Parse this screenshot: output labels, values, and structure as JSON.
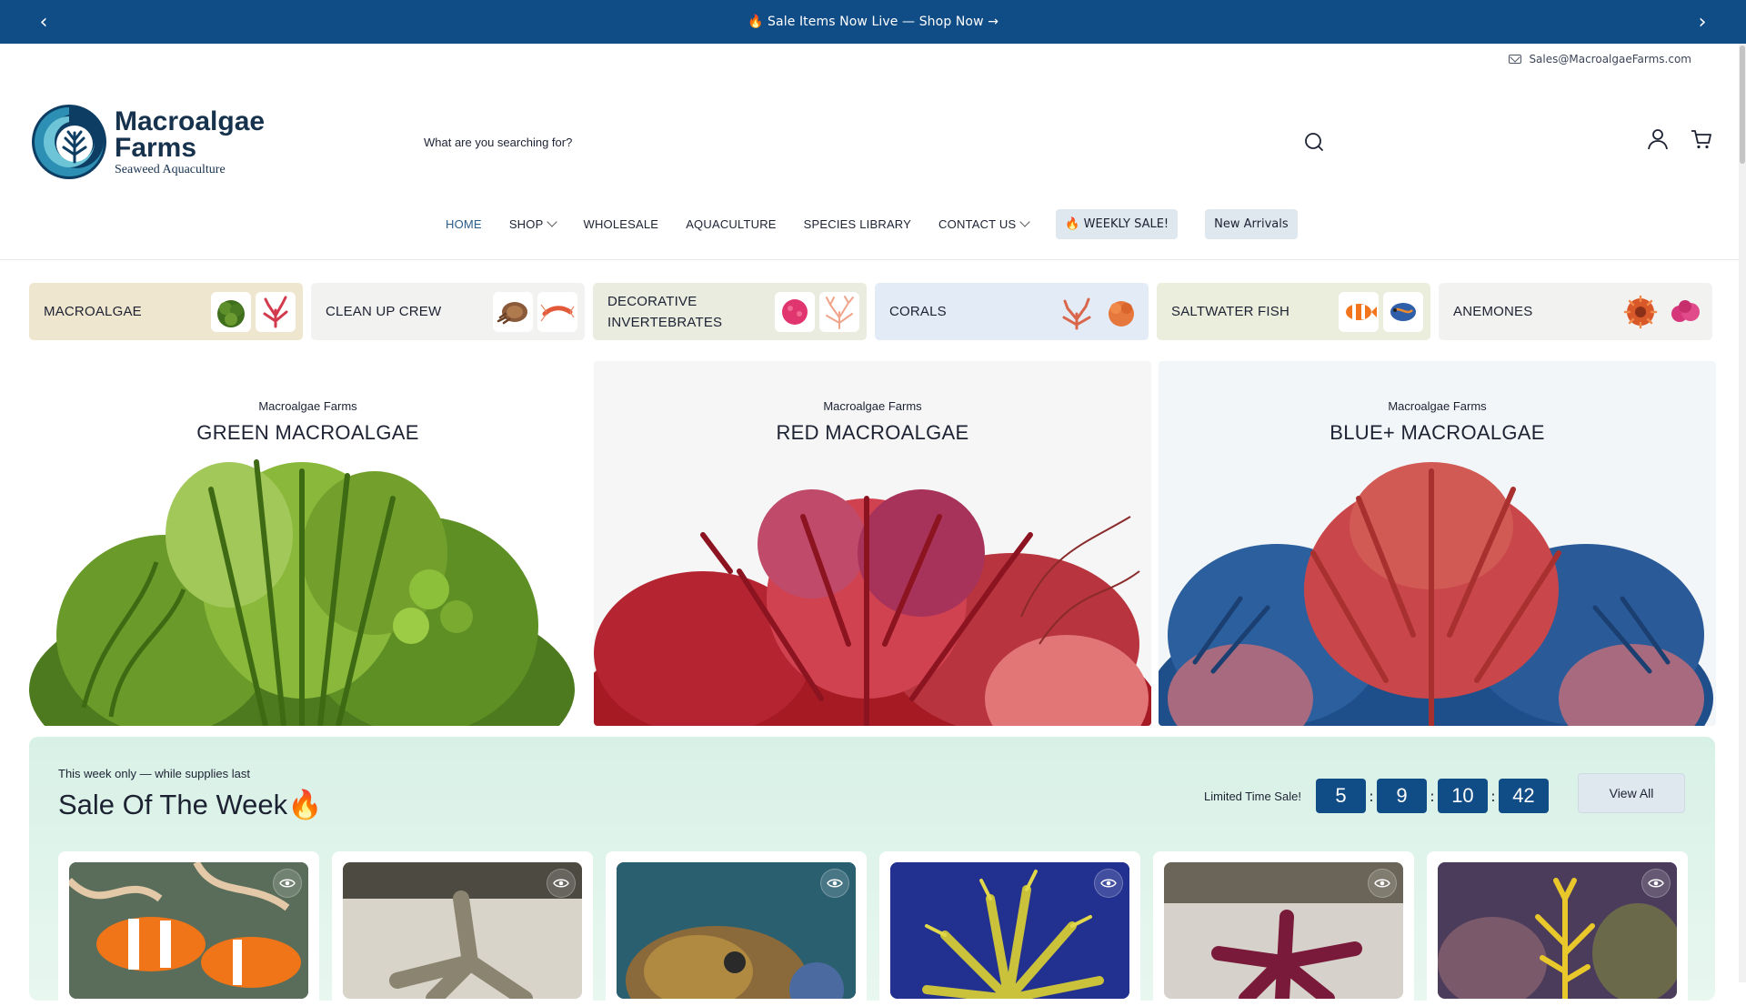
{
  "announcement": {
    "message": "🔥 Sale Items Now Live — Shop Now →",
    "prev_icon": "chevron-left-icon",
    "next_icon": "chevron-right-icon"
  },
  "utility": {
    "email": "Sales@MacroalgaeFarms.com",
    "email_icon": "mail-icon"
  },
  "header": {
    "logo_name_line1": "Macroalgae",
    "logo_name_line2": "Farms",
    "logo_tagline": "Seaweed Aquaculture",
    "search_placeholder": "What are you searching for?",
    "search_icon": "search-icon",
    "account_icon": "user-icon",
    "cart_icon": "cart-icon"
  },
  "nav": {
    "items": [
      {
        "label": "HOME",
        "active": true,
        "dropdown": false
      },
      {
        "label": "SHOP",
        "active": false,
        "dropdown": true
      },
      {
        "label": "WHOLESALE",
        "active": false,
        "dropdown": false
      },
      {
        "label": "AQUACULTURE",
        "active": false,
        "dropdown": false
      },
      {
        "label": "SPECIES LIBRARY",
        "active": false,
        "dropdown": false
      },
      {
        "label": "CONTACT US",
        "active": false,
        "dropdown": true
      }
    ],
    "weekly_sale": "🔥 WEEKLY SALE!",
    "new_arrivals": "New Arrivals"
  },
  "categories": [
    {
      "label": "MACROALGAE",
      "bg": "#efe6cf"
    },
    {
      "label": "CLEAN UP CREW",
      "bg": "#f2f2f0"
    },
    {
      "label": "DECORATIVE INVERTEBRATES",
      "bg": "#e9ecdf"
    },
    {
      "label": "CORALS",
      "bg": "#e3ecf6"
    },
    {
      "label": "SALTWATER FISH",
      "bg": "#ebeedc"
    },
    {
      "label": "ANEMONES",
      "bg": "#f2f2f0"
    }
  ],
  "hero": [
    {
      "brand": "Macroalgae Farms",
      "title": "GREEN MACROALGAE"
    },
    {
      "brand": "Macroalgae Farms",
      "title": "RED MACROALGAE"
    },
    {
      "brand": "Macroalgae Farms",
      "title": "BLUE+ MACROALGAE"
    }
  ],
  "sale": {
    "kicker": "This week only — while supplies last",
    "heading": "Sale Of The Week🔥",
    "timer_label": "Limited Time Sale!",
    "timer": [
      "5",
      "9",
      "10",
      "42"
    ],
    "view_all": "View All",
    "products": [
      {
        "name": "clownfish",
        "eye_icon": "eye-icon"
      },
      {
        "name": "sand-sifting-starfish",
        "eye_icon": "eye-icon"
      },
      {
        "name": "cuttlefish",
        "eye_icon": "eye-icon"
      },
      {
        "name": "yellow-feather-star",
        "eye_icon": "eye-icon"
      },
      {
        "name": "red-starfish",
        "eye_icon": "eye-icon"
      },
      {
        "name": "yellow-sea-cucumber",
        "eye_icon": "eye-icon"
      }
    ]
  },
  "colors": {
    "brand_blue": "#104c86",
    "sale_bg": "#d8f1e6",
    "pill_bg": "#dfe8ef"
  }
}
